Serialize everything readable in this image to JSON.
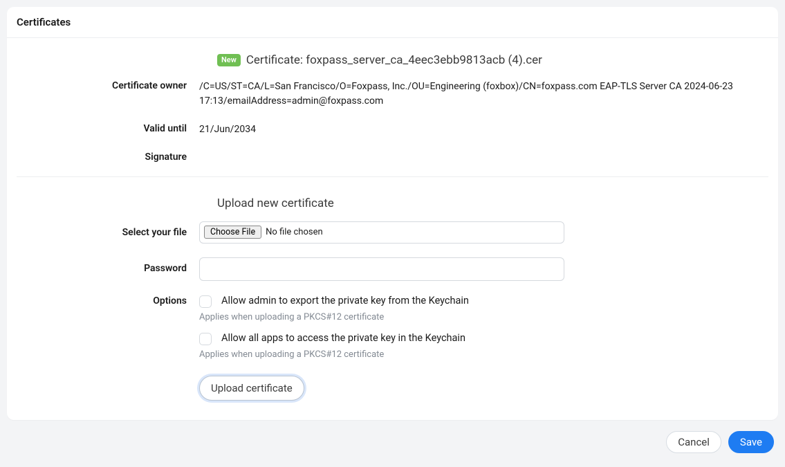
{
  "header": {
    "title": "Certificates"
  },
  "certificate": {
    "badge": "New",
    "title": "Certificate: foxpass_server_ca_4eec3ebb9813acb (4).cer",
    "labels": {
      "owner": "Certificate owner",
      "valid_until": "Valid until",
      "signature": "Signature"
    },
    "owner": "/C=US/ST=CA/L=San Francisco/O=Foxpass, Inc./OU=Engineering (foxbox)/CN=foxpass.com EAP-TLS Server CA 2024-06-23 17:13/emailAddress=admin@foxpass.com",
    "valid_until": "21/Jun/2034",
    "signature": ""
  },
  "upload": {
    "section_title": "Upload new certificate",
    "labels": {
      "select_file": "Select your file",
      "password": "Password",
      "options": "Options"
    },
    "file": {
      "button_label": "Choose File",
      "status": "No file chosen"
    },
    "password_value": "",
    "options": {
      "allow_admin_export": {
        "label": "Allow admin to export the private key from the Keychain",
        "checked": false,
        "hint": "Applies when uploading a PKCS#12 certificate"
      },
      "allow_all_apps": {
        "label": "Allow all apps to access the private key in the Keychain",
        "checked": false,
        "hint": "Applies when uploading a PKCS#12 certificate"
      }
    },
    "upload_button_label": "Upload certificate"
  },
  "footer": {
    "cancel_label": "Cancel",
    "save_label": "Save"
  }
}
